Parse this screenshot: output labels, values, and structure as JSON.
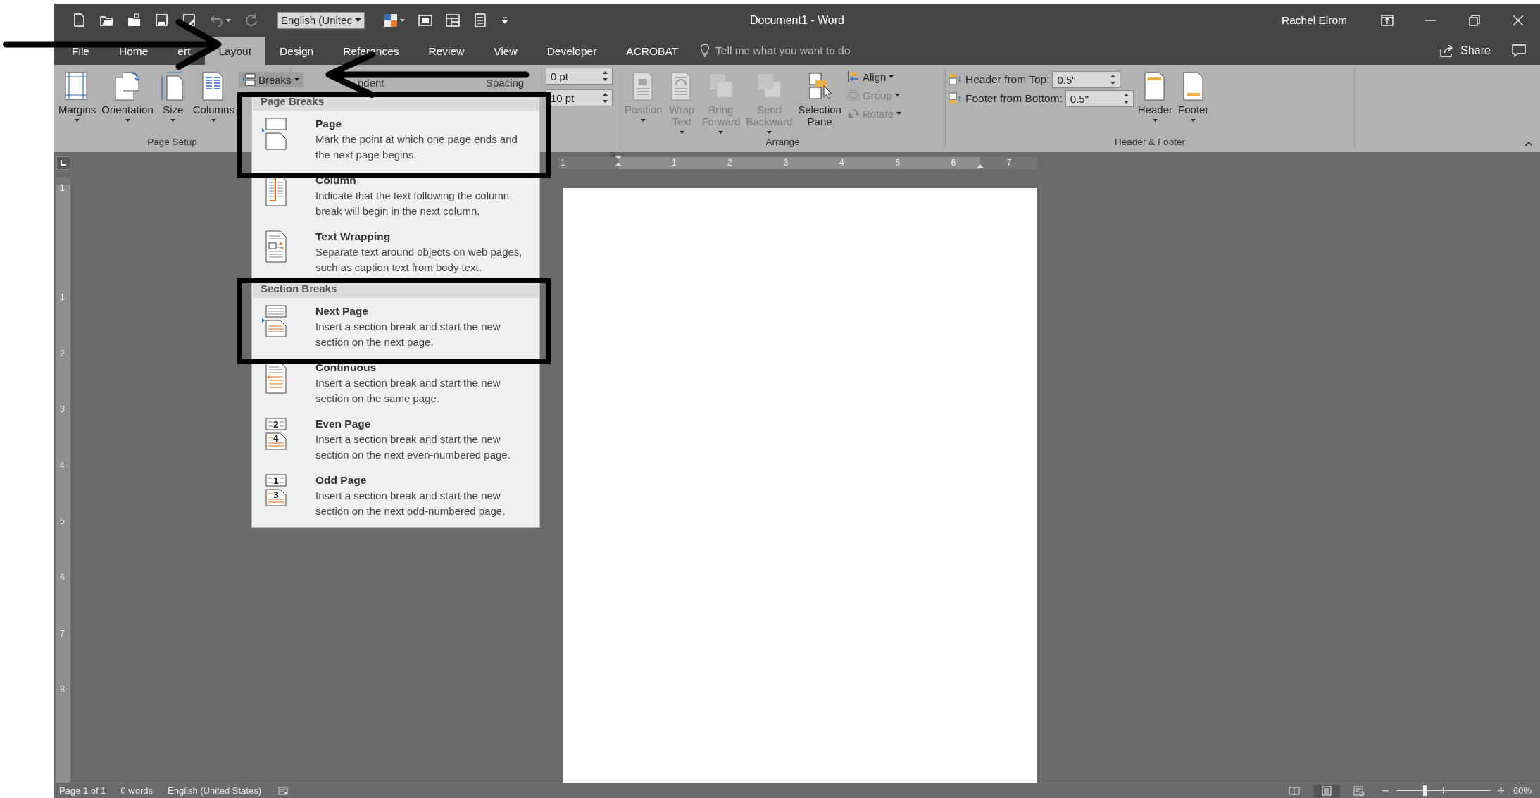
{
  "window": {
    "title": "Document1  -  Word",
    "user": "Rachel Elrom"
  },
  "quick_access": [
    {
      "kind": "new",
      "disabled": false
    },
    {
      "kind": "open",
      "disabled": false
    },
    {
      "kind": "folder",
      "disabled": false
    },
    {
      "kind": "save",
      "disabled": false
    },
    {
      "kind": "save-as",
      "disabled": false
    },
    {
      "kind": "undo",
      "disabled": true
    },
    {
      "kind": "redo",
      "disabled": true
    }
  ],
  "language_box": "English (Unitec",
  "quick_access_right": [
    {
      "kind": "theme-colors"
    },
    {
      "kind": "screen"
    },
    {
      "kind": "table"
    },
    {
      "kind": "form"
    },
    {
      "kind": "customize"
    }
  ],
  "tabs": [
    {
      "label": "File",
      "selected": false
    },
    {
      "label": "Home",
      "selected": false
    },
    {
      "label": "ert",
      "selected": false
    },
    {
      "label": "Layout",
      "selected": true
    },
    {
      "label": "Design",
      "selected": false
    },
    {
      "label": "References",
      "selected": false
    },
    {
      "label": "Review",
      "selected": false
    },
    {
      "label": "View",
      "selected": false
    },
    {
      "label": "Developer",
      "selected": false
    },
    {
      "label": "ACROBAT",
      "selected": false
    }
  ],
  "tell_me": {
    "placeholder": "Tell me what you want to do"
  },
  "share": "Share",
  "ribbon": {
    "page_setup": {
      "label": "Page Setup",
      "buttons": [
        {
          "label": "Margins",
          "kind": "margins"
        },
        {
          "label": "Orientation",
          "kind": "orientation"
        },
        {
          "label": "Size",
          "kind": "size"
        },
        {
          "label": "Columns",
          "kind": "columns"
        }
      ],
      "breaks": "Breaks"
    },
    "paragraph": {
      "indent_label": "ndent",
      "spacing_label": "Spacing",
      "spacing_before": "0 pt",
      "spacing_after": "10 pt"
    },
    "arrange": {
      "label": "Arrange",
      "buttons": [
        {
          "label": "Position",
          "kind": "position",
          "disabled": true,
          "dropdown": true
        },
        {
          "label": "Wrap Text",
          "kind": "wrap",
          "disabled": true,
          "dropdown": true
        },
        {
          "label": "Bring Forward",
          "kind": "bring",
          "disabled": true,
          "dropdown": true
        },
        {
          "label": "Send Backward",
          "kind": "send",
          "disabled": true,
          "dropdown": true
        },
        {
          "label": "Selection Pane",
          "kind": "selection",
          "disabled": false,
          "dropdown": false
        }
      ],
      "small_buttons": [
        {
          "label": "Align",
          "kind": "align",
          "disabled": false
        },
        {
          "label": "Group",
          "kind": "group",
          "disabled": true
        },
        {
          "label": "Rotate",
          "kind": "rotate",
          "disabled": true
        }
      ]
    },
    "header_footer": {
      "label": "Header & Footer",
      "fields": [
        {
          "label": "Header from Top:",
          "value": "0.5\"",
          "kind": "header"
        },
        {
          "label": "Footer from Bottom:",
          "value": "0.5\"",
          "kind": "footer"
        }
      ],
      "buttons": [
        {
          "label": "Header",
          "kind": "header"
        },
        {
          "label": "Footer",
          "kind": "footer"
        }
      ]
    }
  },
  "breaks_menu": [
    {
      "heading": "Page Breaks",
      "items": [
        {
          "kind": "page",
          "title": "Page",
          "description": "Mark the point at which one page ends and the next page begins."
        },
        {
          "kind": "column",
          "title": "Column",
          "description": "Indicate that the text following the column break will begin in the next column."
        },
        {
          "kind": "wrap",
          "title": "Text Wrapping",
          "description": "Separate text around objects on web pages, such as caption text from body text."
        }
      ]
    },
    {
      "heading": "Section Breaks",
      "items": [
        {
          "kind": "next",
          "title": "Next Page",
          "description": "Insert a section break and start the new section on the next page."
        },
        {
          "kind": "continuous",
          "title": "Continuous",
          "description": "Insert a section break and start the new section on the same page."
        },
        {
          "kind": "even",
          "title": "Even Page",
          "description": "Insert a section break and start the new section on the next even-numbered page.",
          "icon_labels": [
            "2",
            "4"
          ]
        },
        {
          "kind": "odd",
          "title": "Odd Page",
          "description": "Insert a section break and start the new section on the next odd-numbered page.",
          "icon_labels": [
            "1",
            "3"
          ]
        }
      ]
    }
  ],
  "horizontal_ruler": [
    "1",
    "1",
    "2",
    "3",
    "4",
    "5",
    "6",
    "7"
  ],
  "vertical_ruler": [
    "1",
    "1",
    "2",
    "3",
    "4",
    "5",
    "6",
    "7",
    "8"
  ],
  "status_bar": {
    "items": [
      "Page 1 of 1",
      "0 words",
      "English (United States)"
    ],
    "views": [
      {
        "kind": "read",
        "selected": false
      },
      {
        "kind": "print",
        "selected": true
      },
      {
        "kind": "web",
        "selected": false
      }
    ],
    "zoom": {
      "level": 0.3,
      "reading": "60%"
    }
  }
}
